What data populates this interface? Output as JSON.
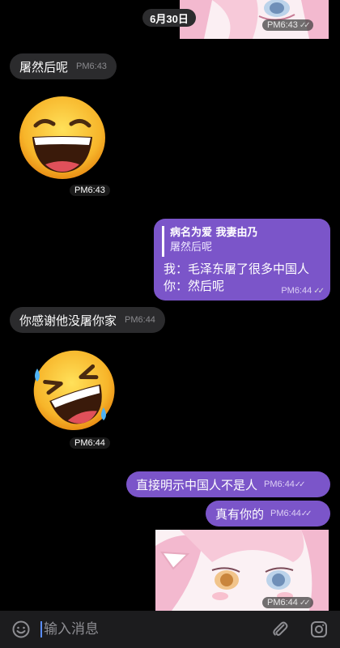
{
  "date_pill": "6月30日",
  "messages": {
    "sticker_top_time": "PM6:43",
    "incoming_1": {
      "text": "屠然后呢",
      "time": "PM6:43"
    },
    "emoji_laugh_time": "PM6:43",
    "reply": {
      "quote_name": "病名为爱 我妻由乃",
      "quote_text": "屠然后呢",
      "line1": "我：毛泽东屠了很多中国人",
      "line2": "你：然后呢",
      "time": "PM6:44"
    },
    "incoming_2": {
      "text": "你感谢他没屠你家",
      "time": "PM6:44"
    },
    "emoji_rofl_time": "PM6:44",
    "outgoing_1": {
      "text": "直接明示中国人不是人",
      "time": "PM6:44"
    },
    "outgoing_2": {
      "text": "真有你的",
      "time": "PM6:44"
    },
    "sticker_bottom_time": "PM6:44"
  },
  "input": {
    "placeholder": "输入消息"
  },
  "icons": [
    "emoji-face-icon",
    "attachment-paperclip-icon",
    "camera-icon",
    "read-double-check-icon"
  ],
  "colors": {
    "outgoing_bubble": "#7b55c9",
    "incoming_bubble": "#2b2b2d",
    "background": "#000000",
    "caret": "#5b8dff"
  }
}
